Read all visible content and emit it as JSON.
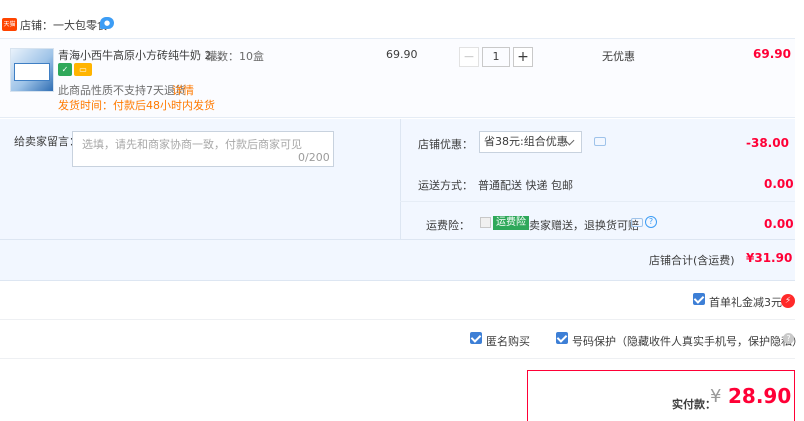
{
  "store": {
    "tag": "天猫",
    "name": "店铺：一大包零食",
    "chat_icon": "chat-bubble-icon"
  },
  "item": {
    "title": "青海小西牛高原小方砖纯牛奶 2...",
    "sku": "罐数：10盒",
    "notice": "此商品性质不支持7天退货",
    "notice_link": "详情",
    "ship_time": "发货时间：付款后48小时内发货",
    "unit_price": "69.90",
    "quantity": "1",
    "minus": "−",
    "plus": "+",
    "discount": "无优惠",
    "subtotal": "69.90"
  },
  "message": {
    "label": "给卖家留言：",
    "placeholder": "选填，请先和商家协商一致，付款后商家可见",
    "count": "0/200"
  },
  "coupon": {
    "label": "店铺优惠：",
    "selected": "省38元:组合优惠",
    "value": "-38.00"
  },
  "shipping": {
    "label": "运送方式：",
    "value": "普通配送 快递 包邮",
    "price": "0.00"
  },
  "insurance": {
    "label": "运费险：",
    "tag": "运费险",
    "desc": "卖家赠送，退换货可赔",
    "price": "0.00"
  },
  "store_total": {
    "label": "店铺合计(含运费)",
    "value": "¥31.90"
  },
  "gift": {
    "label": "首单礼金减3元",
    "icon": "lightning-icon"
  },
  "anon": {
    "label": "匿名购买"
  },
  "phone": {
    "label": "号码保护（隐藏收件人真实手机号，保护隐私）"
  },
  "pay": {
    "label": "实付款：",
    "yen": "¥",
    "amount": "28.90"
  },
  "colors": {
    "accent": "#ff0036",
    "blue": "#3d7fd6",
    "orange": "#ff7a00",
    "panel": "#f2f7ff"
  }
}
